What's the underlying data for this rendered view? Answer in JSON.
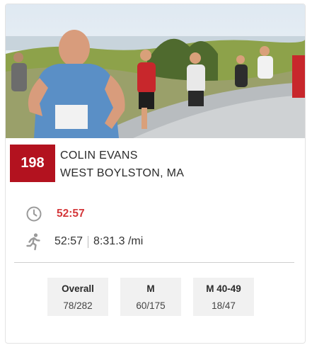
{
  "runner": {
    "bib": "198",
    "name": "COLIN EVANS",
    "location": "WEST BOYLSTON, MA"
  },
  "result": {
    "gun_time": "52:57",
    "chip_time": "52:57",
    "pace": "8:31.3 /mi"
  },
  "icons": {
    "clock": "clock-icon",
    "runner": "runner-icon"
  },
  "colors": {
    "bib_bg": "#b3121f",
    "gun_time": "#d4373a",
    "rank_bg": "#f1f1f1"
  },
  "ranks": [
    {
      "label": "Overall",
      "value": "78/282"
    },
    {
      "label": "M",
      "value": "60/175"
    },
    {
      "label": "M 40-49",
      "value": "18/47"
    }
  ]
}
